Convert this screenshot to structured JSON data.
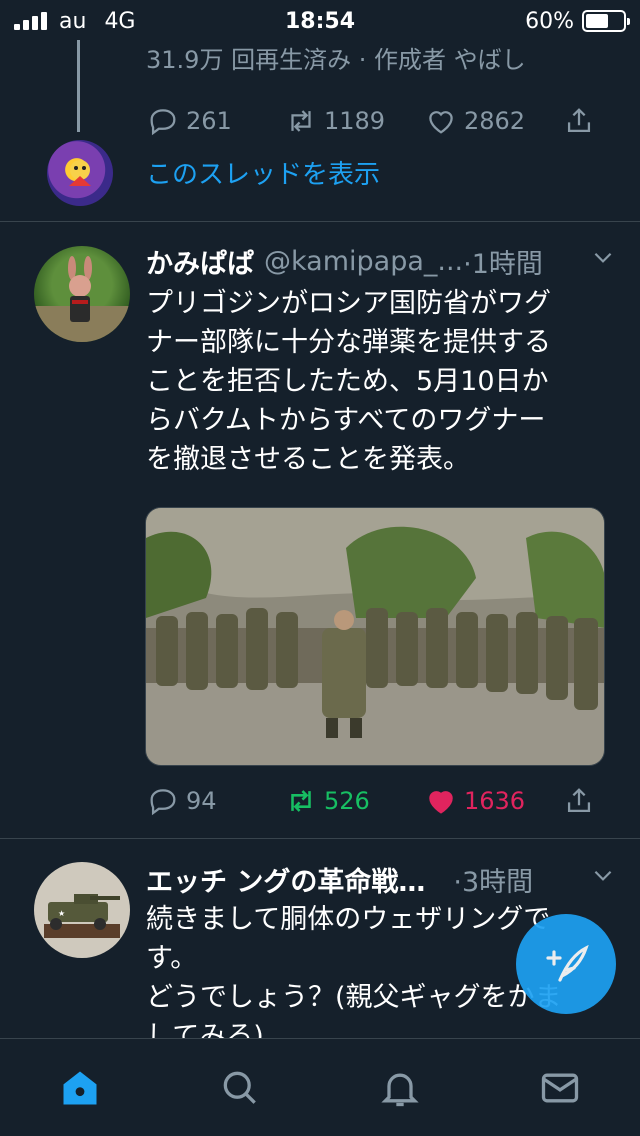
{
  "status": {
    "carrier": "au",
    "network": "4G",
    "time": "18:54",
    "battery": "60%"
  },
  "prev_tweet": {
    "meta": "31.9万 回再生済み · 作成者 やばし",
    "reply_count": "261",
    "retweet_count": "1189",
    "like_count": "2862",
    "show_thread": "このスレッドを表示"
  },
  "tweet1": {
    "name": "かみぱぱ",
    "handle": "@kamipapa_...",
    "time": "·1時間",
    "lines": [
      "プリゴジンがロシア国防省がワグ",
      "ナー部隊に十分な弾薬を提供する",
      "ことを拒否したため、5月10日か",
      "らバクムトからすべてのワグナー",
      "を撤退させることを発表。"
    ],
    "reply_count": "94",
    "retweet_count": "526",
    "like_count": "1636"
  },
  "tweet2": {
    "name": "エッチ ングの革命戦…",
    "time": "·3時間",
    "lines": [
      "続きまして胴体のウェザリングで",
      "す。",
      "どうでしょう？(親父ギャグをかま",
      "してみる)"
    ]
  },
  "colors": {
    "accent": "#1da1f2",
    "retweet": "#17bf63",
    "like": "#e0245e",
    "bg": "#15202b",
    "muted": "#8899a6"
  },
  "icons": [
    "reply-icon",
    "retweet-icon",
    "like-icon",
    "share-icon",
    "chevron-down-icon",
    "compose-icon",
    "home-icon",
    "search-icon",
    "notifications-icon",
    "messages-icon"
  ]
}
